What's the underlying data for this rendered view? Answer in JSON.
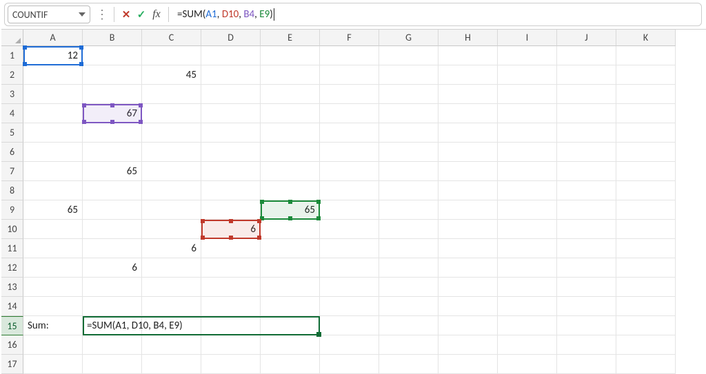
{
  "formula_bar": {
    "name_box": "COUNTIF",
    "formula_prefix": "=SUM(",
    "ref_a1": "A1",
    "ref_d10": "D10",
    "ref_b4": "B4",
    "ref_e9": "E9",
    "comma_sp": ", ",
    "close_paren": ")"
  },
  "columns": [
    "A",
    "B",
    "C",
    "D",
    "E",
    "F",
    "G",
    "H",
    "I",
    "J",
    "K"
  ],
  "rows": [
    "1",
    "2",
    "3",
    "4",
    "5",
    "6",
    "7",
    "8",
    "9",
    "10",
    "11",
    "12",
    "13",
    "14",
    "15",
    "16",
    "17"
  ],
  "cells": {
    "A1": "12",
    "C2": "45",
    "B4": "67",
    "B7": "65",
    "A9": "65",
    "E9": "65",
    "D10": "6",
    "C11": "6",
    "B12": "6",
    "A15": "Sum:",
    "B15_formula": "=SUM(A1, D10, B4, E9)"
  },
  "icons": {
    "dots": "⋮",
    "cancel": "✕",
    "confirm": "✓",
    "fx": "fx"
  },
  "colors": {
    "ref_blue": "#1f6cd6",
    "ref_red": "#c0392b",
    "ref_purple": "#7e57c2",
    "ref_green": "#1b8a3a",
    "edit_border": "#0f6b34"
  },
  "chart_data": {
    "type": "table",
    "title": "Spreadsheet cells with formula editing",
    "active_formula": "=SUM(A1, D10, B4, E9)",
    "references": [
      {
        "cell": "A1",
        "value": 12,
        "color": "blue"
      },
      {
        "cell": "D10",
        "value": 6,
        "color": "red"
      },
      {
        "cell": "B4",
        "value": 67,
        "color": "purple"
      },
      {
        "cell": "E9",
        "value": 65,
        "color": "green"
      }
    ],
    "non_empty_cells": [
      {
        "cell": "A1",
        "value": 12
      },
      {
        "cell": "C2",
        "value": 45
      },
      {
        "cell": "B4",
        "value": 67
      },
      {
        "cell": "B7",
        "value": 65
      },
      {
        "cell": "A9",
        "value": 65
      },
      {
        "cell": "E9",
        "value": 65
      },
      {
        "cell": "D10",
        "value": 6
      },
      {
        "cell": "C11",
        "value": 6
      },
      {
        "cell": "B12",
        "value": 6
      },
      {
        "cell": "A15",
        "value": "Sum:"
      },
      {
        "cell": "B15",
        "value": "=SUM(A1, D10, B4, E9)"
      }
    ]
  }
}
